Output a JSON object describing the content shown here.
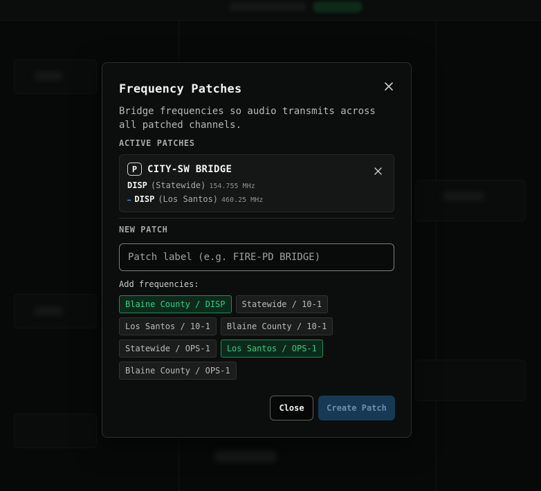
{
  "modal": {
    "title": "Frequency Patches",
    "description": "Bridge frequencies so audio transmits across all patched channels.",
    "active_label": "ACTIVE PATCHES",
    "new_label": "NEW PATCH",
    "add_label": "Add frequencies:",
    "close_label": "Close",
    "create_label": "Create Patch"
  },
  "active_patch": {
    "badge": "P",
    "name": "CITY-SW BRIDGE",
    "frequencies": [
      {
        "channel": "DISP",
        "zone": "(Statewide)",
        "mhz": "154.755 MHz",
        "arrow": ""
      },
      {
        "channel": "DISP",
        "zone": "(Los Santos)",
        "mhz": "460.25 MHz",
        "arrow": "↔"
      }
    ]
  },
  "input": {
    "placeholder": "Patch label (e.g. FIRE-PD BRIDGE)",
    "value": ""
  },
  "chips": [
    {
      "label": "Blaine County / DISP",
      "selected": true
    },
    {
      "label": "Statewide / 10-1",
      "selected": false
    },
    {
      "label": "Los Santos / 10-1",
      "selected": false
    },
    {
      "label": "Blaine County / 10-1",
      "selected": false
    },
    {
      "label": "Statewide / OPS-1",
      "selected": false
    },
    {
      "label": "Los Santos / OPS-1",
      "selected": true
    },
    {
      "label": "Blaine County / OPS-1",
      "selected": false
    }
  ],
  "icons": {
    "modal_close": "close-icon",
    "patch_remove": "close-icon"
  },
  "colors": {
    "selected_chip": "#2fd080",
    "primary_button": "#163956",
    "link_arrow": "#4ea3ff"
  }
}
